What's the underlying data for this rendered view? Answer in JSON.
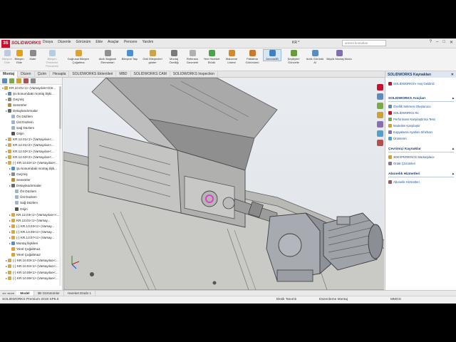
{
  "app": {
    "logo_text": "SOLIDWORKS",
    "menus": [
      "Dosya",
      "Düzenle",
      "Görünüm",
      "Ekle",
      "Araçlar",
      "Pencere",
      "Yardım"
    ],
    "doc_title": "KR *",
    "search_placeholder": "arama komutları",
    "window_buttons": [
      "?",
      "–",
      "□",
      "✕"
    ]
  },
  "command_manager": [
    {
      "label": "Bileşeni Ekle",
      "state": "disabled",
      "color": "#7a9cc6"
    },
    {
      "label": "Bileşen Ekle",
      "state": "normal",
      "color": "#e0a020"
    },
    {
      "label": "Mate",
      "state": "normal",
      "color": "#8a8a8a"
    },
    {
      "label": "Bileşen Önizleme Penceresi",
      "state": "disabled",
      "color": "#6aa0d0"
    },
    {
      "label": "Doğrusal Bileşen Çoğaltma",
      "state": "normal",
      "color": "#d9a23a"
    },
    {
      "label": "Akıllı Bağlantı Elemanları",
      "state": "normal",
      "color": "#909090"
    },
    {
      "label": "Bileşeni Taşı",
      "state": "normal",
      "color": "#4f8fcf"
    },
    {
      "label": "Gizli Bileşenleri göster",
      "state": "normal",
      "color": "#c9a44a"
    },
    {
      "label": "Montaj Özelliği",
      "state": "normal",
      "color": "#7a7a7a"
    },
    {
      "label": "Referans Geometri",
      "state": "normal",
      "color": "#b0b0b0"
    },
    {
      "label": "Yeni Hareket Etüdü",
      "state": "normal",
      "color": "#4ca34c"
    },
    {
      "label": "Malzeme Listesi",
      "state": "normal",
      "color": "#d08c2a"
    },
    {
      "label": "Patlatma Görünümü",
      "state": "normal",
      "color": "#c97a30"
    },
    {
      "label": "Anında3B",
      "state": "active",
      "color": "#3f7fc0"
    },
    {
      "label": "Şeçiliyleri Güncelle",
      "state": "normal",
      "color": "#6a9a3a"
    },
    {
      "label": "Anlık Görüntü Al",
      "state": "normal",
      "color": "#5a8cc0"
    },
    {
      "label": "Büyük Montaj Modu",
      "state": "normal",
      "color": "#7f6fb0"
    }
  ],
  "tabs": [
    "Montaj",
    "Düzen",
    "Çizim",
    "Hesapla",
    "SOLIDWORKS Eklentileri",
    "MBD",
    "SOLIDWORKS CAM",
    "SOLIDWORKS Inspection"
  ],
  "active_tab": "Montaj",
  "tree_tool_colors": [
    "#5a8cc0",
    "#7aa84a",
    "#d0a030",
    "#b05050",
    "#888888"
  ],
  "tree": [
    {
      "label": "KR.10.01<1> (Varsayılan<Gör...",
      "indent": 0,
      "arrow": "▾",
      "color": "#d7a84a"
    },
    {
      "label": "Şu konumdaki montaj ilişki...",
      "indent": 1,
      "arrow": "▸",
      "color": "#5b8ec8"
    },
    {
      "label": "Geçmiş",
      "indent": 1,
      "arrow": "▸",
      "color": "#8a8a8a"
    },
    {
      "label": "Sensörler",
      "indent": 1,
      "arrow": "",
      "color": "#b98a3a"
    },
    {
      "label": "Detaylandırmalar",
      "indent": 1,
      "arrow": "▸",
      "color": "#6a6a6a"
    },
    {
      "label": "Ön Düzlem",
      "indent": 2,
      "arrow": "",
      "color": "#9fb4cc"
    },
    {
      "label": "Üst Düzlem",
      "indent": 2,
      "arrow": "",
      "color": "#9fb4cc"
    },
    {
      "label": "Sağ Düzlem",
      "indent": 2,
      "arrow": "",
      "color": "#9fb4cc"
    },
    {
      "label": "Orijin",
      "indent": 2,
      "arrow": "",
      "color": "#555555"
    },
    {
      "label": "KR.12.01<1> (Varsayılan<...",
      "indent": 1,
      "arrow": "▸",
      "color": "#d7a84a"
    },
    {
      "label": "KR.12.01<2> (Varsayılan<...",
      "indent": 1,
      "arrow": "▸",
      "color": "#d7a84a"
    },
    {
      "label": "KR.12.02<1> (Varsayılan<...",
      "indent": 1,
      "arrow": "▸",
      "color": "#d7a84a"
    },
    {
      "label": "KR.12.02<2> (Varsayılan<...",
      "indent": 1,
      "arrow": "▸",
      "color": "#d7a84a"
    },
    {
      "label": "(-) KR.10.02<1> (Varsayılan<...",
      "indent": 1,
      "arrow": "▾",
      "color": "#d7a84a"
    },
    {
      "label": "Şu konumdaki montaj ilişk...",
      "indent": 2,
      "arrow": "▸",
      "color": "#5b8ec8"
    },
    {
      "label": "Geçmiş",
      "indent": 2,
      "arrow": "▸",
      "color": "#8a8a8a"
    },
    {
      "label": "Sensörler",
      "indent": 2,
      "arrow": "",
      "color": "#b98a3a"
    },
    {
      "label": "Detaylandırmalar",
      "indent": 2,
      "arrow": "▸",
      "color": "#6a6a6a"
    },
    {
      "label": "Ön Düzlem",
      "indent": 3,
      "arrow": "",
      "color": "#9fb4cc"
    },
    {
      "label": "Üst Düzlem",
      "indent": 3,
      "arrow": "",
      "color": "#9fb4cc"
    },
    {
      "label": "Sağ Düzlem",
      "indent": 3,
      "arrow": "",
      "color": "#9fb4cc"
    },
    {
      "label": "Orijin",
      "indent": 3,
      "arrow": "",
      "color": "#555555"
    },
    {
      "label": "KR.12.03<1> (Varsayılan<<...",
      "indent": 2,
      "arrow": "▸",
      "color": "#d7a84a"
    },
    {
      "label": "KR.13.01<1> (Varsay...",
      "indent": 2,
      "arrow": "▸",
      "color": "#d7a84a"
    },
    {
      "label": "(-) KR.13.03<1> (Varsay...",
      "indent": 2,
      "arrow": "▸",
      "color": "#d7a84a"
    },
    {
      "label": "(-) KR.13.06<1> (Varsay...",
      "indent": 2,
      "arrow": "▸",
      "color": "#d7a84a"
    },
    {
      "label": "(-) KR.13.07<1> (Varsay...",
      "indent": 2,
      "arrow": "▸",
      "color": "#d7a84a"
    },
    {
      "label": "Montaj İlişkileri",
      "indent": 2,
      "arrow": "▸",
      "color": "#5b8ec8"
    },
    {
      "label": "Yerel Çoğaltma1",
      "indent": 2,
      "arrow": "",
      "color": "#d9a23a"
    },
    {
      "label": "Yerel Çoğaltma2",
      "indent": 2,
      "arrow": "",
      "color": "#d9a23a"
    },
    {
      "label": "(-) KR.10.03<1> (Varsayılan<...",
      "indent": 1,
      "arrow": "▸",
      "color": "#d7a84a"
    },
    {
      "label": "(-) KR.10.04<1> (Varsayılan<...",
      "indent": 1,
      "arrow": "▸",
      "color": "#d7a84a"
    },
    {
      "label": "(-) KR.10.05<1> (Varsayılan<...",
      "indent": 1,
      "arrow": "▸",
      "color": "#d7a84a"
    },
    {
      "label": "(-) KR.10.06<1> (Varsayılan<...",
      "indent": 1,
      "arrow": "▸",
      "color": "#d7a84a"
    }
  ],
  "task_pane": {
    "title": "SOLIDWORKS Kaynakları",
    "intro_item": "SOLIDWORKS'e Hoş Geldiniz",
    "sections": [
      {
        "title": "SOLIDWORKS Araçları",
        "items": [
          "Özellik Sekmesi Oluşturucu",
          "SOLIDWORKS Rx",
          "Performans Karşılaştırma Testi",
          "Modelimi Karşılaştır",
          "Kopyalama Ayarları Sihirbazı",
          "Ürünlerim"
        ]
      },
      {
        "title": "Çevrimiçi Kaynaklar",
        "items": [
          "3DEXPERIENCE Marketplace",
          "Ortak Çözümleri"
        ]
      },
      {
        "title": "Abonelik Hizmetleri",
        "items": [
          "Abonelik Hizmetleri"
        ]
      }
    ],
    "icon_colors": [
      "#c8102e",
      "#5a8cc0",
      "#7aa84a",
      "#d0a030",
      "#8a6fb0",
      "#4f9fcf",
      "#b05050"
    ]
  },
  "bottom_tabs": [
    "Model",
    "3B Görünümler",
    "Hareket Etüdü 1"
  ],
  "active_bottom_tab": "Model",
  "status": {
    "version": "SOLIDWORKS Premium 2019 SP5.0",
    "state": "Eksik Tanımlı",
    "mode": "Düzenleme Montaj",
    "units": "MMGS"
  },
  "colors": {
    "brand": "#c8102e",
    "selection": "#e040c8"
  }
}
